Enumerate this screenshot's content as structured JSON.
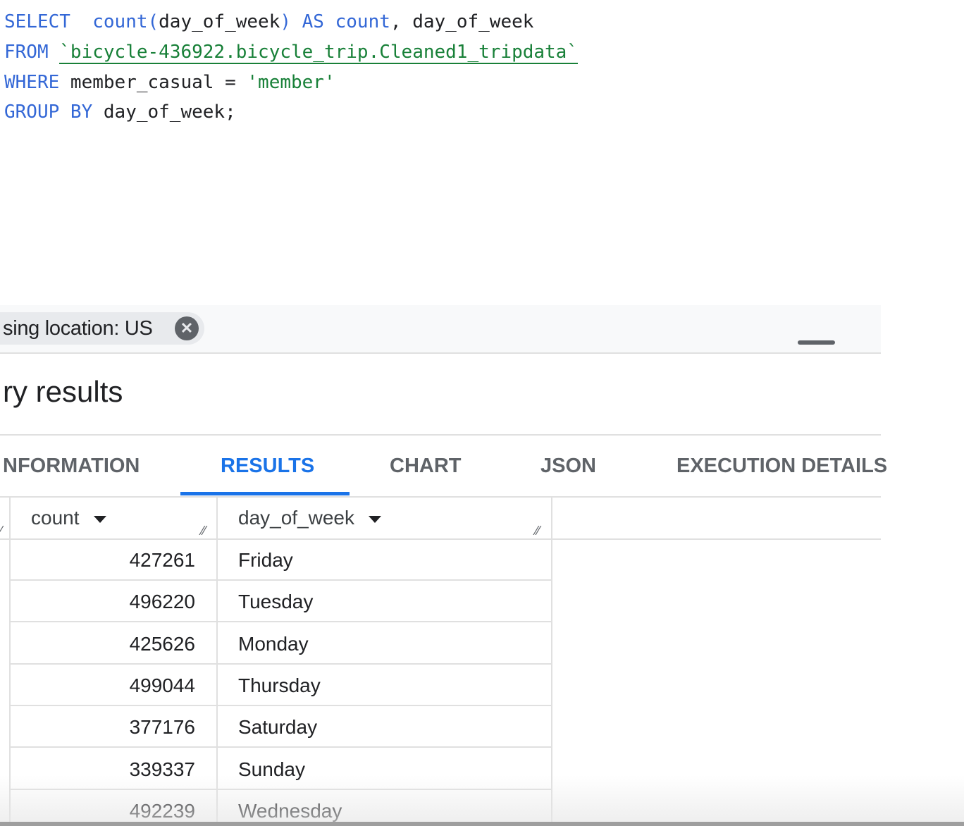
{
  "editor": {
    "lines": [
      [
        {
          "t": "SELECT",
          "c": "kw"
        },
        {
          "t": "  ",
          "c": ""
        },
        {
          "t": "count(",
          "c": "fn"
        },
        {
          "t": "day_of_week",
          "c": ""
        },
        {
          "t": ")",
          "c": "fn"
        },
        {
          "t": " ",
          "c": ""
        },
        {
          "t": "AS",
          "c": "kw"
        },
        {
          "t": " ",
          "c": ""
        },
        {
          "t": "count",
          "c": "fn"
        },
        {
          "t": ", day_of_week",
          "c": ""
        }
      ],
      [
        {
          "t": "FROM",
          "c": "kw"
        },
        {
          "t": " ",
          "c": ""
        },
        {
          "t": "`bicycle-436922.bicycle_trip.Cleaned1_tripdata`",
          "c": "tbl"
        }
      ],
      [
        {
          "t": "WHERE",
          "c": "kw"
        },
        {
          "t": " member_casual = ",
          "c": ""
        },
        {
          "t": "'member'",
          "c": "str"
        }
      ],
      [
        {
          "t": "GROUP BY",
          "c": "kw"
        },
        {
          "t": " day_of_week;",
          "c": ""
        }
      ]
    ]
  },
  "location_chip": {
    "text": "sing location: US",
    "close_glyph": "✕"
  },
  "results": {
    "title": "ry results"
  },
  "tabs": [
    {
      "label": "NFORMATION",
      "active": false
    },
    {
      "label": "RESULTS",
      "active": true
    },
    {
      "label": "CHART",
      "active": false
    },
    {
      "label": "JSON",
      "active": false
    },
    {
      "label": "EXECUTION DETAILS",
      "active": false
    }
  ],
  "table": {
    "columns": [
      "count",
      "day_of_week"
    ],
    "rows": [
      {
        "count": "427261",
        "day": "Friday"
      },
      {
        "count": "496220",
        "day": "Tuesday"
      },
      {
        "count": "425626",
        "day": "Monday"
      },
      {
        "count": "499044",
        "day": "Thursday"
      },
      {
        "count": "377176",
        "day": "Saturday"
      },
      {
        "count": "339337",
        "day": "Sunday"
      },
      {
        "count": "492239",
        "day": "Wednesday"
      }
    ]
  },
  "colors": {
    "keyword": "#3367d6",
    "string": "#188038",
    "accent": "#1a73e8"
  }
}
